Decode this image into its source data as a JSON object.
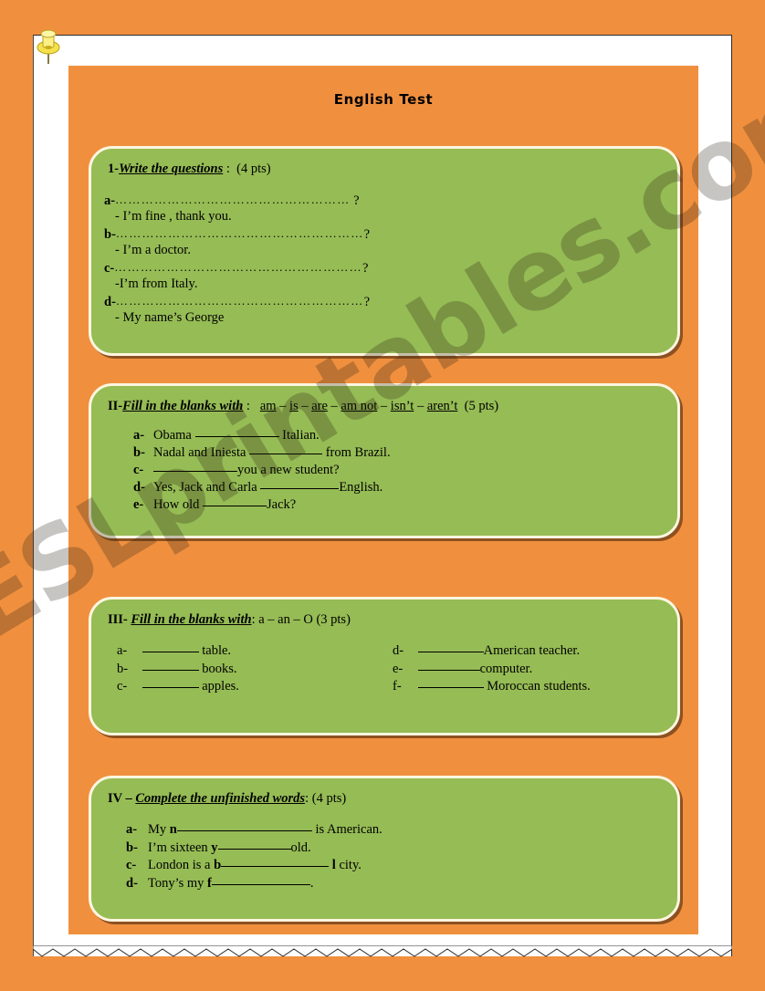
{
  "document": {
    "title": "English Test",
    "watermark": "ESLprintables.com",
    "colors": {
      "page_orange": "#f0903f",
      "exercise_green": "#96bc55",
      "box_border_cream": "#fdf6e0",
      "paper_white": "#ffffff",
      "text_black": "#000000"
    },
    "pushpin_color": "#f5e14a"
  },
  "exercises": [
    {
      "number": "1-",
      "instruction": "Write the questions",
      "separator": ":",
      "points": "(4 pts)",
      "questions": [
        {
          "label": "a-",
          "dots": "………………………………………………",
          "mark": "?",
          "answer": "- I’m fine , thank you."
        },
        {
          "label": "b-",
          "dots": "…………………………………………………",
          "mark": "?",
          "answer": "- I’m a doctor."
        },
        {
          "label": "c-",
          "dots": "…………………………………………………",
          "mark": "?",
          "answer": "-I’m from Italy."
        },
        {
          "label": "d-",
          "dots": "…………………………………………………",
          "mark": "?",
          "answer": "- My name’s George"
        }
      ]
    },
    {
      "number": "II-",
      "instruction": "Fill in the blanks with",
      "separator": ":",
      "options": [
        "am",
        "is",
        "are",
        "am not",
        "isn’t",
        "aren’t"
      ],
      "option_separator": " – ",
      "points": "(5 pts)",
      "items": [
        {
          "label": "a-",
          "before": "Obama",
          "blank_width": 92,
          "after": "Italian."
        },
        {
          "label": "b-",
          "before": "Nadal and Iniesta",
          "blank_width": 80,
          "after": "from Brazil."
        },
        {
          "label": "c-",
          "before": "",
          "blank_width": 92,
          "after": "you a new student?"
        },
        {
          "label": "d-",
          "before": "Yes, Jack and Carla",
          "blank_width": 86,
          "after": "English."
        },
        {
          "label": "e-",
          "before": "How old",
          "blank_width": 70,
          "after": "Jack?"
        }
      ]
    },
    {
      "number": "III-",
      "instruction": "Fill in the blanks with",
      "separator": ":",
      "options_text": "a – an – O",
      "points": "(3 pts)",
      "left_items": [
        {
          "label": "a-",
          "blank_width": 62,
          "after": "table."
        },
        {
          "label": "b-",
          "blank_width": 62,
          "after": "books."
        },
        {
          "label": "c-",
          "blank_width": 62,
          "after": "apples."
        }
      ],
      "right_items": [
        {
          "label": "d-",
          "blank_width": 72,
          "after": "American teacher."
        },
        {
          "label": "e-",
          "blank_width": 68,
          "after": "computer."
        },
        {
          "label": "f-",
          "blank_width": 72,
          "after": "Moroccan students."
        }
      ]
    },
    {
      "number": "IV –",
      "instruction": "Complete the unfinished words",
      "separator": ":",
      "points": "(4 pts)",
      "items": [
        {
          "label": "a-",
          "before": "My",
          "seed": "n",
          "blank_width": 148,
          "after": "is American."
        },
        {
          "label": "b-",
          "before": "I’m sixteen",
          "seed": "y",
          "blank_width": 80,
          "after": "old."
        },
        {
          "label": "c-",
          "before": "London is a",
          "seed": "b",
          "blank_width": 118,
          "after_seed": "l",
          "after": "city."
        },
        {
          "label": "d-",
          "before": "Tony’s my",
          "seed": "f",
          "blank_width": 108,
          "after": "."
        }
      ]
    }
  ]
}
